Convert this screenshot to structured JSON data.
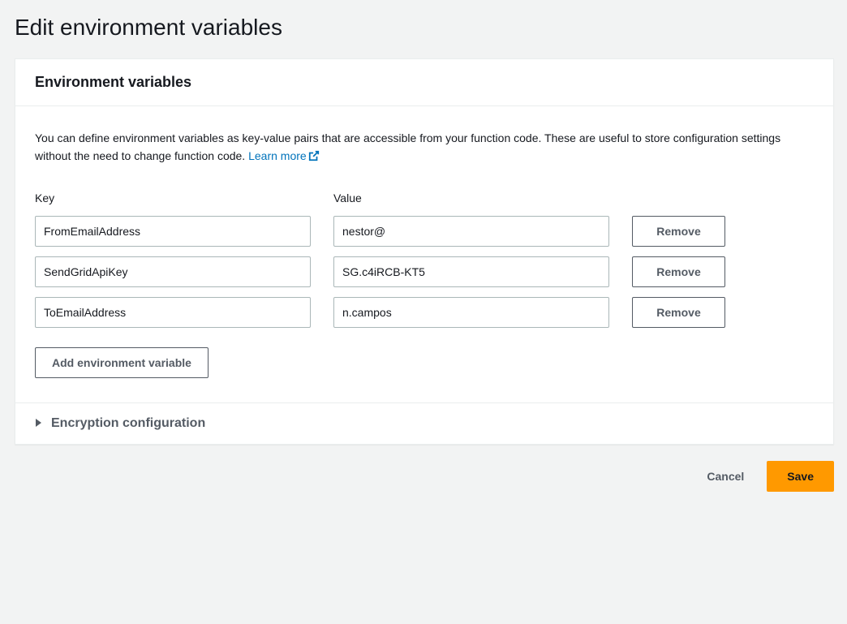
{
  "page_title": "Edit environment variables",
  "card": {
    "title": "Environment variables",
    "description": "You can define environment variables as key-value pairs that are accessible from your function code. These are useful to store configuration settings without the need to change function code. ",
    "learn_more_label": "Learn more"
  },
  "columns": {
    "key_label": "Key",
    "value_label": "Value"
  },
  "rows": [
    {
      "key": "FromEmailAddress",
      "value": "nestor@"
    },
    {
      "key": "SendGridApiKey",
      "value": "SG.c4iRCB-KT5"
    },
    {
      "key": "ToEmailAddress",
      "value": "n.campos"
    }
  ],
  "buttons": {
    "remove": "Remove",
    "add": "Add environment variable",
    "cancel": "Cancel",
    "save": "Save"
  },
  "encryption": {
    "title": "Encryption configuration"
  },
  "colors": {
    "primary": "#ff9900",
    "link": "#0073bb",
    "border": "#aab7b8",
    "text": "#16191f"
  }
}
